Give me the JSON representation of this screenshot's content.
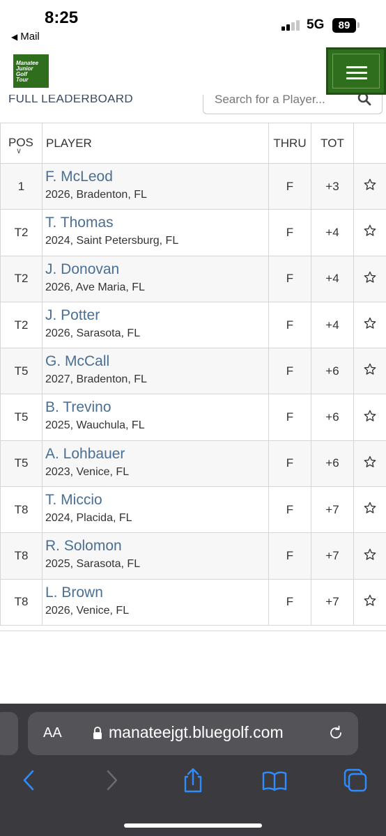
{
  "status_bar": {
    "time": "8:25",
    "back_app": "Mail",
    "network": "5G",
    "battery": "89"
  },
  "header": {
    "logo_lines": [
      "Manatee",
      "Junior",
      "Golf",
      "Tour"
    ],
    "brand_color": "#2e6e1d",
    "menu_icon": "hamburger-icon"
  },
  "toolbar": {
    "title": "FULL LEADERBOARD",
    "search_placeholder": "Search for a Player...",
    "search_icon": "search-icon"
  },
  "table": {
    "columns": {
      "pos": "POS",
      "player": "PLAYER",
      "thru": "THRU",
      "tot": "TOT"
    },
    "rows": [
      {
        "pos": "1",
        "name": "F. McLeod",
        "info": "2026, Bradenton, FL",
        "thru": "F",
        "tot": "+3"
      },
      {
        "pos": "T2",
        "name": "T. Thomas",
        "info": "2024, Saint Petersburg, FL",
        "thru": "F",
        "tot": "+4"
      },
      {
        "pos": "T2",
        "name": "J. Donovan",
        "info": "2026, Ave Maria, FL",
        "thru": "F",
        "tot": "+4"
      },
      {
        "pos": "T2",
        "name": "J. Potter",
        "info": "2026, Sarasota, FL",
        "thru": "F",
        "tot": "+4"
      },
      {
        "pos": "T5",
        "name": "G. McCall",
        "info": "2027, Bradenton, FL",
        "thru": "F",
        "tot": "+6"
      },
      {
        "pos": "T5",
        "name": "B. Trevino",
        "info": "2025, Wauchula, FL",
        "thru": "F",
        "tot": "+6"
      },
      {
        "pos": "T5",
        "name": "A. Lohbauer",
        "info": "2023, Venice, FL",
        "thru": "F",
        "tot": "+6"
      },
      {
        "pos": "T8",
        "name": "T. Miccio",
        "info": "2024, Placida, FL",
        "thru": "F",
        "tot": "+7"
      },
      {
        "pos": "T8",
        "name": "R. Solomon",
        "info": "2025, Sarasota, FL",
        "thru": "F",
        "tot": "+7"
      },
      {
        "pos": "T8",
        "name": "L. Brown",
        "info": "2026, Venice, FL",
        "thru": "F",
        "tot": "+7"
      }
    ]
  },
  "safari": {
    "aa_label": "AA",
    "url": "manateejgt.bluegolf.com",
    "nav_icons": [
      "back-icon",
      "forward-icon",
      "share-icon",
      "bookmarks-icon",
      "tabs-icon"
    ]
  }
}
